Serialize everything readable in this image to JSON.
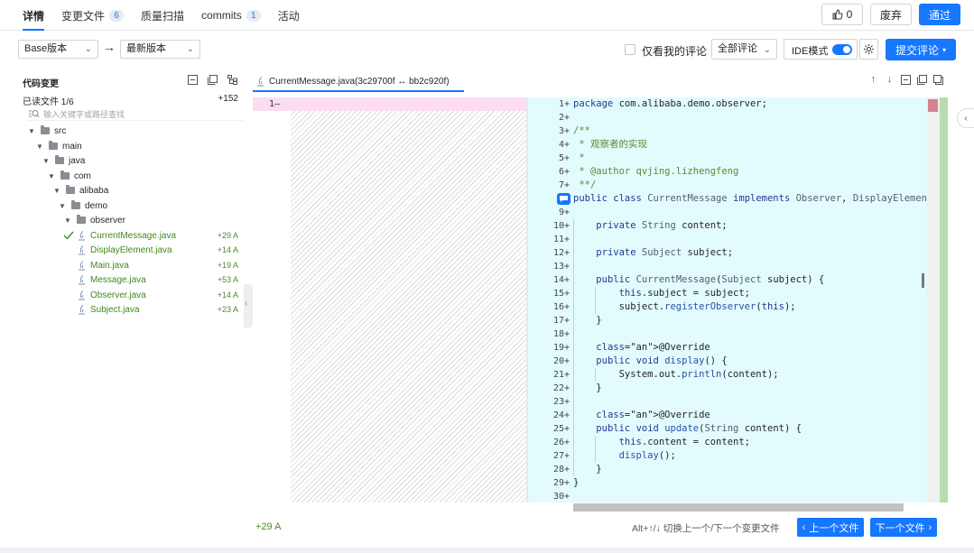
{
  "tabs": [
    {
      "label": "详情",
      "badge": ""
    },
    {
      "label": "变更文件",
      "badge": "6"
    },
    {
      "label": "质量扫描",
      "badge": ""
    },
    {
      "label": "commits",
      "badge": "1"
    },
    {
      "label": "活动",
      "badge": ""
    }
  ],
  "actions": {
    "like_count": "0",
    "discard": "废弃",
    "approve": "通过"
  },
  "toolbar": {
    "base_version": "Base版本",
    "latest_version": "最新版本",
    "only_mine": "仅看我的评论",
    "all_comments": "全部评论",
    "ide_mode": "IDE模式",
    "submit_comment": "提交评论"
  },
  "sidebar": {
    "title": "代码变更",
    "read_label": "已读文件 1/6",
    "read_added": "+152",
    "search_placeholder": "输入关键字或路径查找",
    "folders": [
      "src",
      "main",
      "java",
      "com",
      "alibaba",
      "demo",
      "observer"
    ],
    "files": [
      {
        "name": "CurrentMessage.java",
        "stat": "+29 A",
        "read": true
      },
      {
        "name": "DisplayElement.java",
        "stat": "+14 A",
        "read": false
      },
      {
        "name": "Main.java",
        "stat": "+19 A",
        "read": false
      },
      {
        "name": "Message.java",
        "stat": "+53 A",
        "read": false
      },
      {
        "name": "Observer.java",
        "stat": "+14 A",
        "read": false
      },
      {
        "name": "Subject.java",
        "stat": "+23 A",
        "read": false
      }
    ]
  },
  "file_tab": "CurrentMessage.java(3c29700f ↔ bb2c920f)",
  "old_line": "1—",
  "code": [
    {
      "n": "1+",
      "t": "package com.alibaba.demo.observer;"
    },
    {
      "n": "2+",
      "t": ""
    },
    {
      "n": "3+",
      "t": "/**"
    },
    {
      "n": "4+",
      "t": " * 观察者的实现"
    },
    {
      "n": "5+",
      "t": " *"
    },
    {
      "n": "6+",
      "t": " * @author qvjing.lizhengfeng"
    },
    {
      "n": "7+",
      "t": " **/"
    },
    {
      "n": "8+",
      "t": "public class CurrentMessage implements Observer, DisplayElement {"
    },
    {
      "n": "9+",
      "t": ""
    },
    {
      "n": "10+",
      "t": "    private String content;"
    },
    {
      "n": "11+",
      "t": ""
    },
    {
      "n": "12+",
      "t": "    private Subject subject;"
    },
    {
      "n": "13+",
      "t": ""
    },
    {
      "n": "14+",
      "t": "    public CurrentMessage(Subject subject) {"
    },
    {
      "n": "15+",
      "t": "        this.subject = subject;"
    },
    {
      "n": "16+",
      "t": "        subject.registerObserver(this);"
    },
    {
      "n": "17+",
      "t": "    }"
    },
    {
      "n": "18+",
      "t": ""
    },
    {
      "n": "19+",
      "t": "    @Override"
    },
    {
      "n": "20+",
      "t": "    public void display() {"
    },
    {
      "n": "21+",
      "t": "        System.out.println(content);"
    },
    {
      "n": "22+",
      "t": "    }"
    },
    {
      "n": "23+",
      "t": ""
    },
    {
      "n": "24+",
      "t": "    @Override"
    },
    {
      "n": "25+",
      "t": "    public void update(String content) {"
    },
    {
      "n": "26+",
      "t": "        this.content = content;"
    },
    {
      "n": "27+",
      "t": "        display();"
    },
    {
      "n": "28+",
      "t": "    }"
    },
    {
      "n": "29+",
      "t": "}"
    },
    {
      "n": "30+",
      "t": ""
    }
  ],
  "footer": {
    "added": "+29 A",
    "hint": "Alt+↑/↓ 切换上一个/下一个变更文件",
    "prev": "上一个文件",
    "next": "下一个文件"
  }
}
